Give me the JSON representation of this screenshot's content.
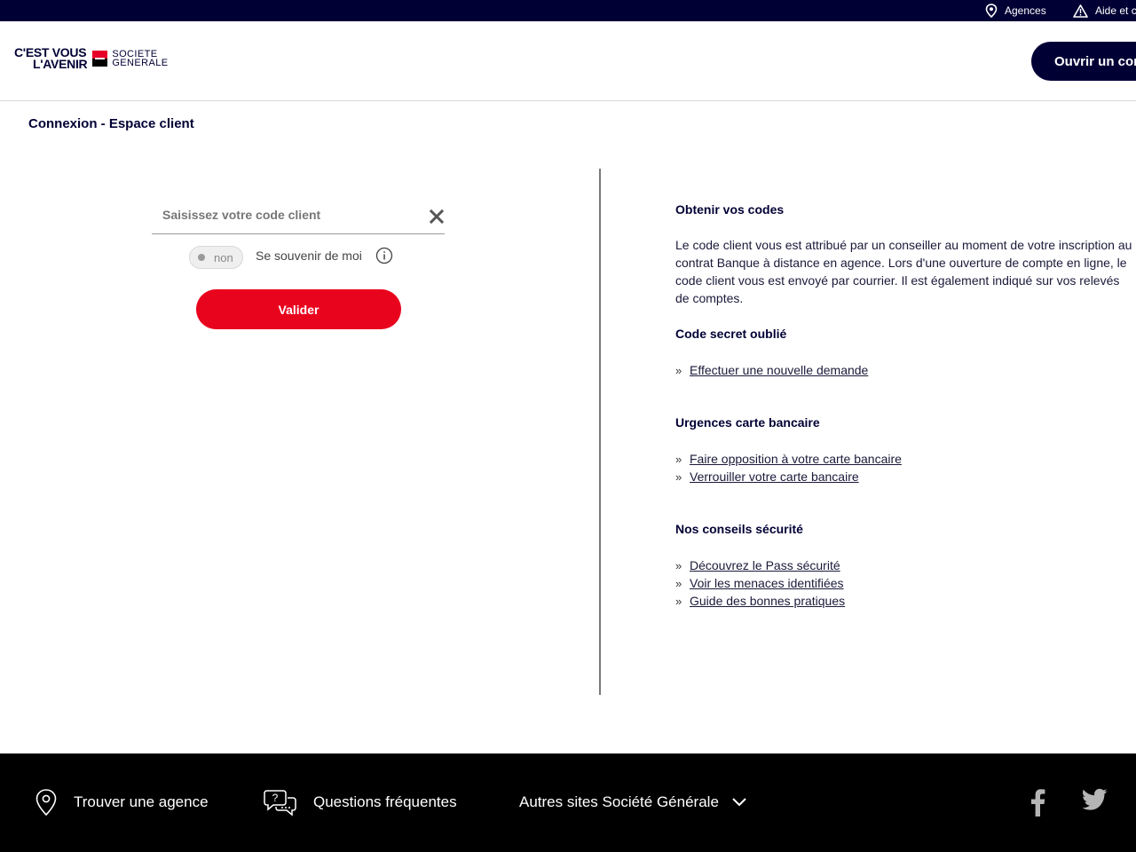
{
  "topbar": {
    "agences_label": "Agences",
    "aide_label": "Aide et c"
  },
  "header": {
    "slogan_line1": "C'EST VOUS",
    "slogan_line2": "L'AVENIR",
    "brand_line1": "SOCIETE",
    "brand_line2": "GENERALE",
    "open_account_label": "Ouvrir un com"
  },
  "page": {
    "title": "Connexion - Espace client"
  },
  "login": {
    "code_placeholder": "Saisissez votre code client",
    "code_value": "",
    "remember_state": "non",
    "remember_label": "Se souvenir de moi",
    "submit_label": "Valider"
  },
  "info": {
    "obtenir_title": "Obtenir vos codes",
    "obtenir_text": "Le code client vous est attribué par un conseiller au moment de votre inscription au contrat Banque à distance en agence. Lors d'une ouverture de compte en ligne, le code client vous est envoyé par courrier. Il est également indiqué sur vos relevés de comptes.",
    "secret_title": "Code secret oublié",
    "secret_links": [
      "Effectuer une nouvelle demande"
    ],
    "urgences_title": "Urgences carte bancaire",
    "urgences_links": [
      "Faire opposition à votre carte bancaire",
      "Verrouiller votre carte bancaire"
    ],
    "conseils_title": "Nos conseils sécurité",
    "conseils_links": [
      "Découvrez le Pass sécurité",
      "Voir les menaces identifiées",
      "Guide des bonnes pratiques"
    ]
  },
  "footer": {
    "agence_label": "Trouver une agence",
    "faq_label": "Questions fréquentes",
    "autres_sites_label": "Autres sites Société Générale"
  },
  "colors": {
    "navy": "#010035",
    "brand_red": "#e9041e",
    "footer_bg": "#000000"
  }
}
